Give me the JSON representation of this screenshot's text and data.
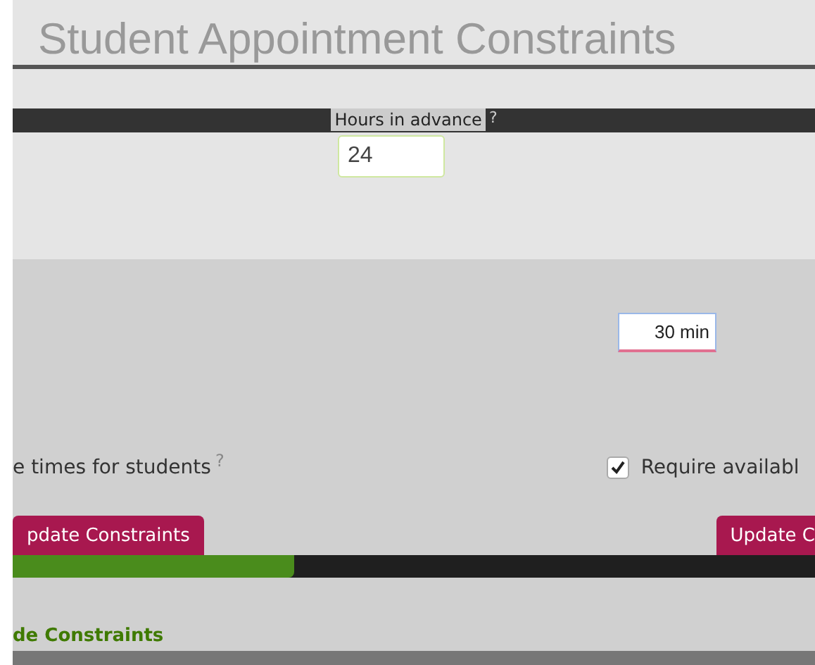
{
  "title": "Student Appointment Constraints",
  "hours_field": {
    "label": "Hours in advance",
    "help": "?",
    "value": "24"
  },
  "duration_field": {
    "value": "30 min"
  },
  "times_option": {
    "label": "e times for students",
    "help": "?"
  },
  "availability_option": {
    "label": "Require availabl",
    "checked": true
  },
  "buttons": [
    {
      "label": "pdate Constraints"
    },
    {
      "label": "Update C"
    }
  ],
  "progress": {
    "level": 0.35
  },
  "link": "de Constraints"
}
